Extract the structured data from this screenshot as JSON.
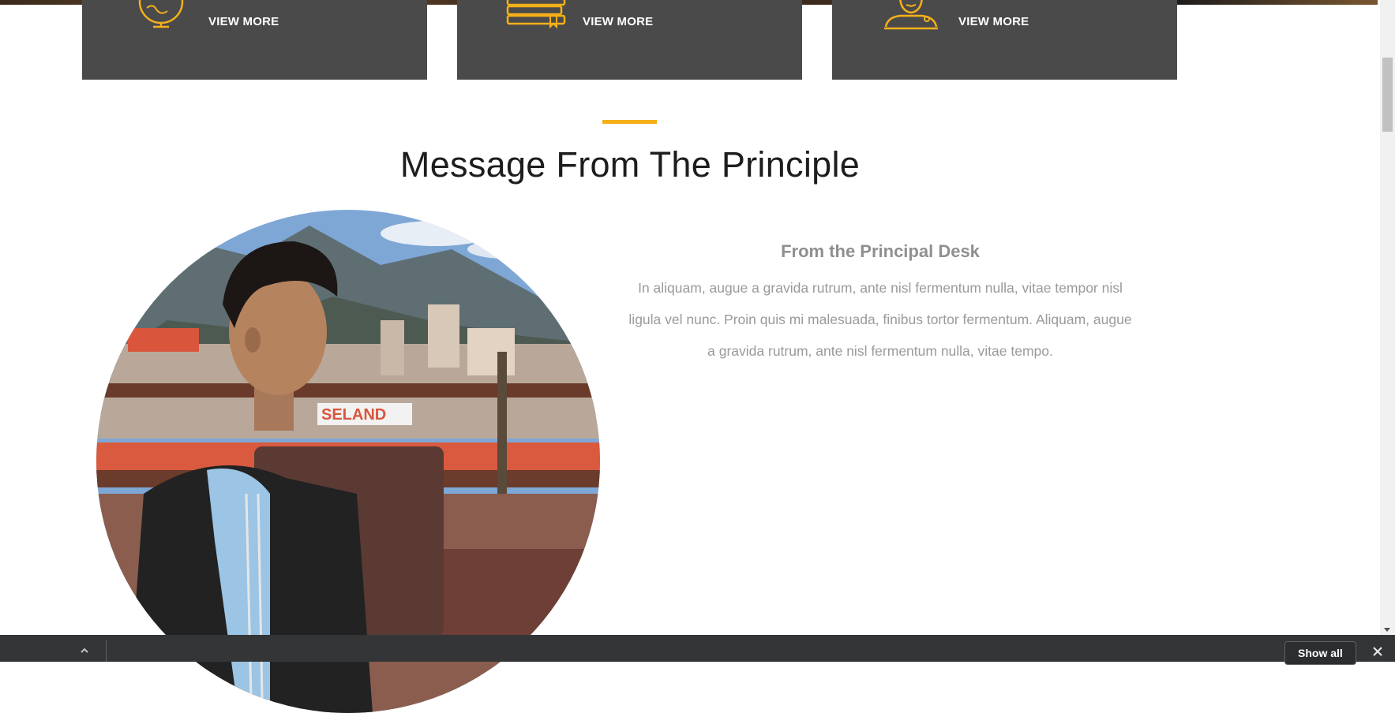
{
  "cards": [
    {
      "label": "VIEW MORE",
      "icon": "globe-icon"
    },
    {
      "label": "VIEW MORE",
      "icon": "books-icon"
    },
    {
      "label": "VIEW MORE",
      "icon": "teacher-icon"
    }
  ],
  "accent_color": "#f5b019",
  "card_color": "#4a4a4a",
  "section": {
    "title": "Message From The Principle"
  },
  "principal": {
    "photo_icon": "principal-photo",
    "desk_title": "From the Principal Desk",
    "desk_text": "In aliquam, augue a gravida rutrum, ante nisl fermentum nulla, vitae tempor nisl ligula vel nunc. Proin quis mi malesuada, finibus tortor fermentum. Aliquam, augue a gravida rutrum, ante nisl fermentum nulla, vitae tempo.",
    "sign_text": "SELAND"
  },
  "download_bar": {
    "show_all": "Show all",
    "expand_icon": "chevron-up-icon",
    "close_icon": "close-icon"
  }
}
